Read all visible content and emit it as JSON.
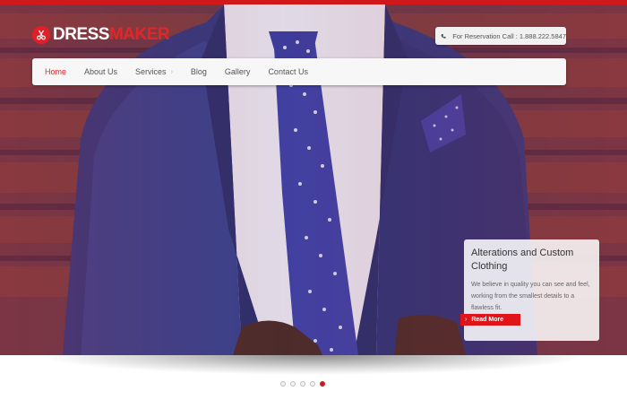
{
  "logo": {
    "text_white": "DRESS",
    "text_red": "MAKER"
  },
  "reservation": {
    "text": "For Reservation Call : 1.888.222.5847",
    "icon": "phone-icon"
  },
  "nav": {
    "items": [
      {
        "label": "Home",
        "active": true
      },
      {
        "label": "About Us"
      },
      {
        "label": "Services",
        "has_submenu": true
      },
      {
        "label": "Blog"
      },
      {
        "label": "Gallery"
      },
      {
        "label": "Contact Us"
      }
    ]
  },
  "slide": {
    "title": "Alterations and Custom Clothing",
    "text": "We believe in quality you can see and feel, working from the smallest details to a flawless fit.",
    "button": "Read More"
  },
  "slider": {
    "total_slides": 5,
    "active_slide": 5
  },
  "colors": {
    "accent": "#e0262b",
    "topbar": "#d0181a",
    "suit": "#2f3f86"
  }
}
